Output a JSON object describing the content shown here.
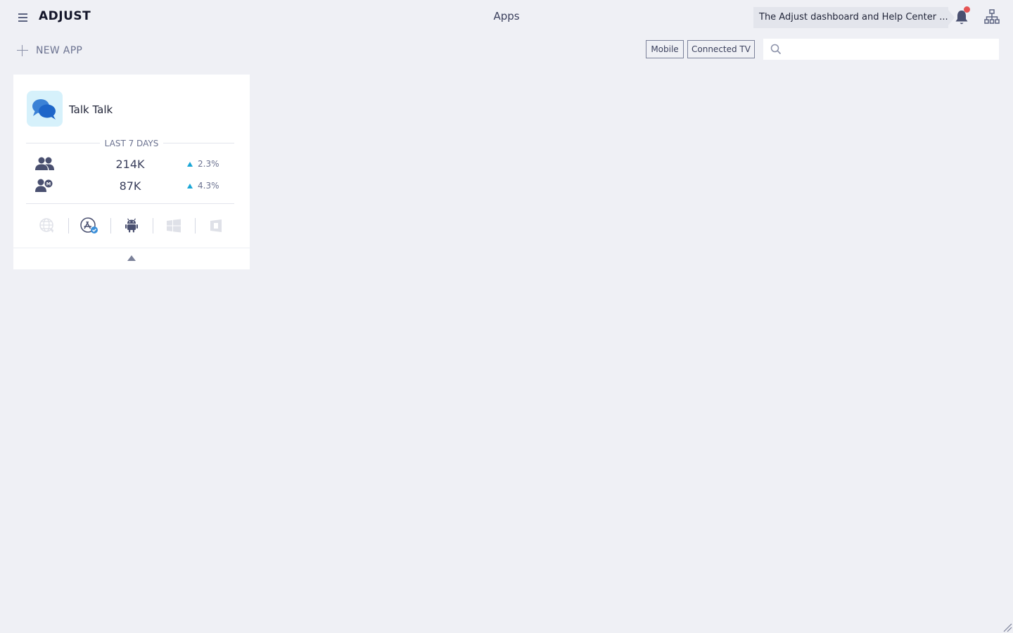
{
  "header": {
    "logo_text": "ADJUST",
    "title": "Apps",
    "announcement": "The Adjust dashboard and Help Center ...",
    "notification_unread": true
  },
  "toolbar": {
    "new_app_label": "NEW APP",
    "filters": [
      "Mobile",
      "Connected TV"
    ],
    "search_value": "",
    "search_placeholder": ""
  },
  "apps": [
    {
      "name": "Talk Talk",
      "period_label": "LAST 7 DAYS",
      "metrics": [
        {
          "icon": "users-icon",
          "value": "214K",
          "change": "2.3%",
          "trend": "up"
        },
        {
          "icon": "monthly-active-users-icon",
          "value": "87K",
          "change": "4.3%",
          "trend": "up"
        }
      ],
      "platforms": [
        {
          "icon": "web-icon",
          "active": false
        },
        {
          "icon": "app-store-icon",
          "active": true,
          "verified": true
        },
        {
          "icon": "android-icon",
          "active": true
        },
        {
          "icon": "windows-icon",
          "active": false
        },
        {
          "icon": "windows-phone-icon",
          "active": false
        }
      ]
    }
  ],
  "colors": {
    "background": "#eff0f5",
    "card": "#ffffff",
    "accent": "#1aa6d6",
    "notification_dot": "#e55353",
    "text_primary": "#3a3f5c",
    "text_muted": "#6b7290"
  }
}
